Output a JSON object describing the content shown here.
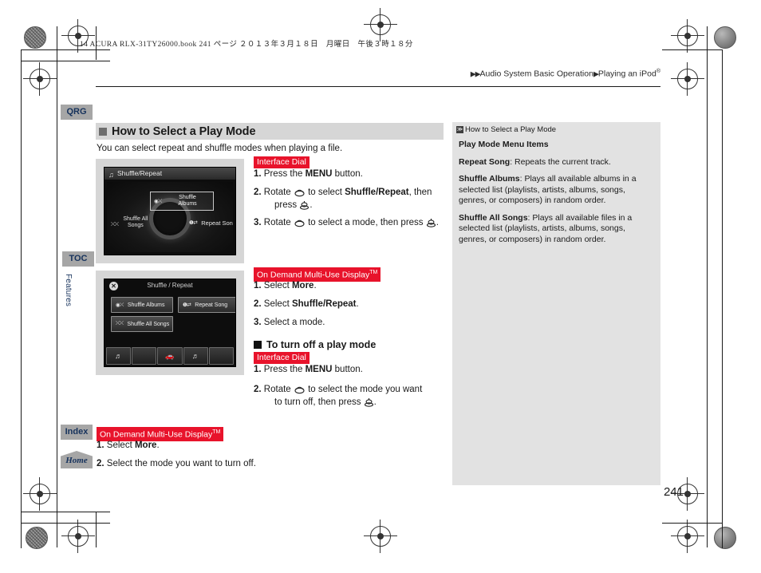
{
  "slug": "14 ACURA RLX-31TY26000.book  241 ページ  ２０１３年３月１８日　月曜日　午後３時１８分",
  "header": {
    "breadcrumb_1": "Audio System Basic Operation",
    "breadcrumb_2": "Playing an iPod",
    "breadcrumb_2_sup": "®",
    "arrow_double": "▶▶",
    "arrow_single": "▶"
  },
  "tabs": {
    "qrg": "QRG",
    "toc": "TOC",
    "features": "Features",
    "index": "Index",
    "home": "Home"
  },
  "main": {
    "section_title": "How to Select a Play Mode",
    "intro": "You can select repeat and shuffle modes when playing a file.",
    "badge_interface_dial": "Interface Dial",
    "badge_odmd": "On Demand Multi-Use Display",
    "badge_odmd_sup": "TM",
    "subhead_turn_off": "To turn off a play mode",
    "steps_dial_1": {
      "n": "1.",
      "pre": "Press the ",
      "bold": "MENU",
      "post": " button."
    },
    "steps_dial_2": {
      "n": "2.",
      "pre": "Rotate ",
      "mid": " to select ",
      "bold": "Shuffle/Repeat",
      "post": ", then",
      "line2_pre": "press ",
      "line2_post": "."
    },
    "steps_dial_3": {
      "n": "3.",
      "pre": "Rotate ",
      "mid": " to select a mode, then press ",
      "post": "."
    },
    "steps_odmd_1": {
      "n": "1.",
      "pre": "Select ",
      "bold": "More",
      "post": "."
    },
    "steps_odmd_2": {
      "n": "2.",
      "pre": "Select ",
      "bold": "Shuffle/Repeat",
      "post": "."
    },
    "steps_odmd_3": {
      "n": "3.",
      "pre": "Select a mode.",
      "bold": "",
      "post": ""
    },
    "off_dial_1": {
      "n": "1.",
      "pre": "Press the ",
      "bold": "MENU",
      "post": " button."
    },
    "off_dial_2": {
      "n": "2.",
      "pre": "Rotate ",
      "mid": " to select the mode you want",
      "line2_pre": "to turn off, then press ",
      "line2_post": "."
    },
    "off_odmd_1": {
      "n": "1.",
      "pre": "Select ",
      "bold": "More",
      "post": "."
    },
    "off_odmd_2": {
      "n": "2.",
      "pre": "Select the mode you want to turn off.",
      "bold": "",
      "post": ""
    }
  },
  "screen_nav": {
    "title": "Shuffle/Repeat",
    "title_icon": "♫",
    "item_shuffle_albums": "Shuffle\nAlbums",
    "item_shuffle_albums_l1": "Shuffle",
    "item_shuffle_albums_l2": "Albums",
    "item_shuffle_all_l1": "Shuffle All",
    "item_shuffle_all_l2": "Songs",
    "item_repeat_song": "Repeat Song",
    "icon_shuffle_albums": "◉⤬",
    "icon_shuffle_all": "⤬⤬",
    "icon_repeat_song": "❶⇄"
  },
  "screen_odmd": {
    "title": "Shuffle / Repeat",
    "close": "✕",
    "btn_shuffle_albums": "Shuffle Albums",
    "btn_repeat_song": "Repeat  Song",
    "btn_shuffle_all_songs": "Shuffle All Songs",
    "icon_shuffle_albums": "◉⤬",
    "icon_repeat_song": "❶⇄",
    "icon_shuffle_all": "⤬⤬",
    "footer_1": "♬",
    "footer_2": "",
    "footer_3": "🚗",
    "footer_4": "♬",
    "footer_5": ""
  },
  "info_panel": {
    "marker": "≫",
    "title": "How to Select a Play Mode",
    "heading": "Play Mode Menu Items",
    "item_1_label": "Repeat Song",
    "item_1_text": ": Repeats the current track.",
    "item_2_label": "Shuffle Albums",
    "item_2_text": ": Plays all available albums in a selected list (playlists, artists, albums, songs, genres, or composers) in random order.",
    "item_3_label": "Shuffle All Songs",
    "item_3_text": ": Plays all available files in a selected list (playlists, artists, albums, songs, genres, or composers) in random order."
  },
  "page_number": "241",
  "colors": {
    "badge_red": "#e8132b",
    "tab_gray": "#a6a6a6",
    "tab_text_blue": "#16325c",
    "section_head_gray": "#d6d6d6",
    "info_panel_gray": "#e2e2e2"
  }
}
